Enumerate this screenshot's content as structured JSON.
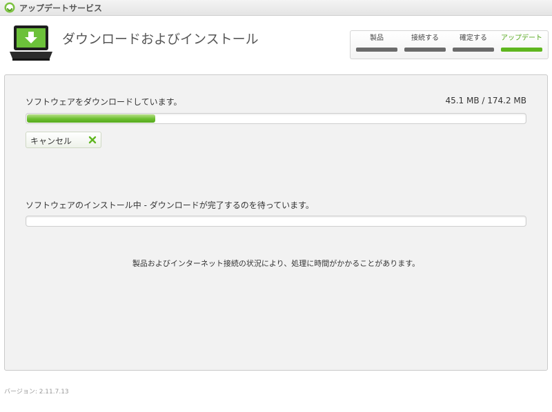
{
  "window": {
    "title": "アップデートサービス"
  },
  "header": {
    "title": "ダウンロードおよびインストール"
  },
  "steps": [
    {
      "label": "製品",
      "active": false
    },
    {
      "label": "接続する",
      "active": false
    },
    {
      "label": "確定する",
      "active": false
    },
    {
      "label": "アップデート",
      "active": true
    }
  ],
  "download": {
    "label": "ソフトウェアをダウンロードしています。",
    "size_text": "45.1 MB / 174.2 MB",
    "progress_percent": 25.9,
    "cancel_label": "キャンセル"
  },
  "install": {
    "label": "ソフトウェアのインストール中 - ダウンロードが完了するのを待っています。",
    "progress_percent": 0
  },
  "note": "製品およびインターネット接続の状況により、処理に時間がかかることがあります。",
  "footer": {
    "version": "バージョン: 2.11.7.13"
  },
  "colors": {
    "accent": "#5fb61f",
    "step_inactive": "#6b6b6b",
    "panel_bg": "#f2f2f2"
  }
}
